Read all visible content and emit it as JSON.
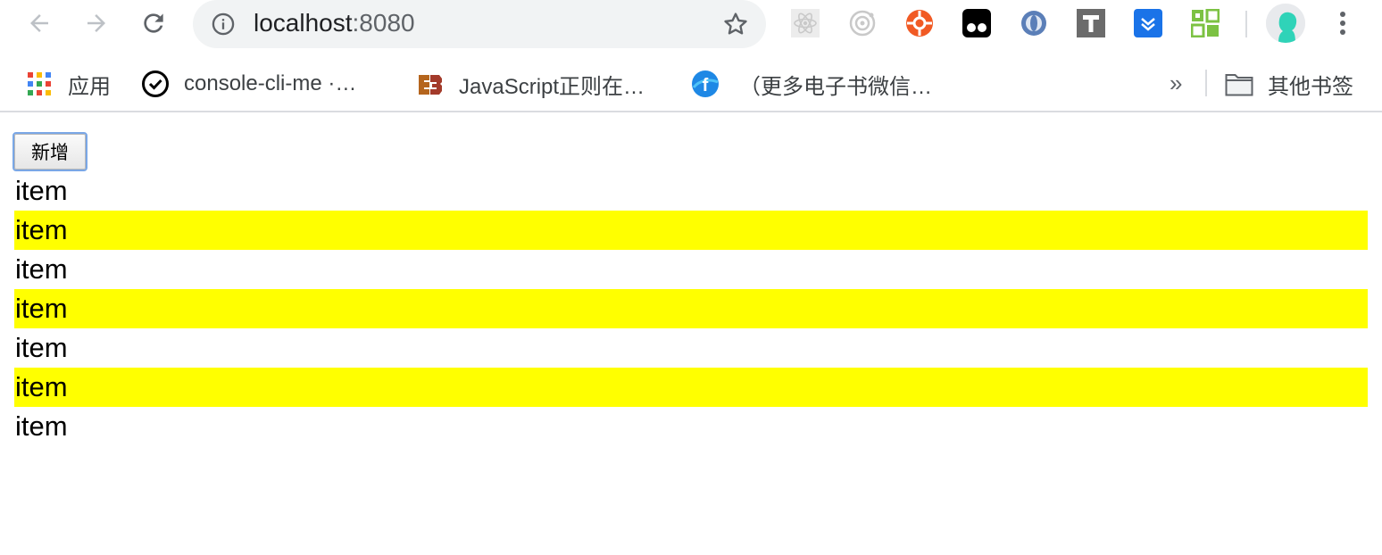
{
  "browser": {
    "url_host": "localhost",
    "url_port": ":8080"
  },
  "bookmarks": [
    {
      "label": "应用",
      "icon": "apps-grid-icon"
    },
    {
      "label": "console-cli-me ·…",
      "icon": "check-circle-icon"
    },
    {
      "label": "JavaScript正则在…",
      "icon": "b-logo-icon"
    },
    {
      "label": "（更多电子书微信…",
      "icon": "f-logo-icon"
    }
  ],
  "bookmarks_overflow": "»",
  "other_bookmarks": "其他书签",
  "page": {
    "add_button": "新增",
    "items": [
      "item",
      "item",
      "item",
      "item",
      "item",
      "item",
      "item"
    ],
    "highlight_color": "#ffff00"
  }
}
